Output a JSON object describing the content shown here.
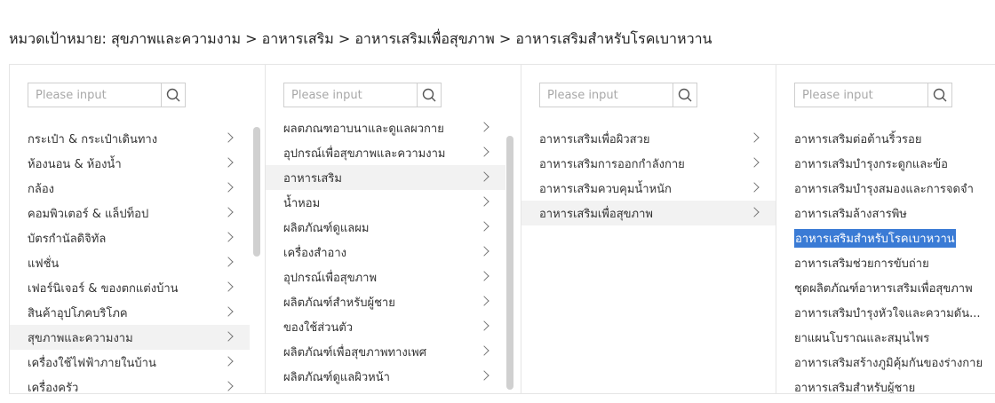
{
  "breadcrumb": {
    "text": "หมวดเป้าหมาย: สุขภาพและความงาม > อาหารเสริม > อาหารเสริมเพื่อสุขภาพ > อาหารเสริมสำหรับโรคเบาหวาน"
  },
  "search_placeholder": "Please input",
  "columns": [
    {
      "items": [
        {
          "label": "กระเป๋า & กระเป๋าเดินทาง"
        },
        {
          "label": "ห้องนอน & ห้องน้ำ"
        },
        {
          "label": "กล้อง"
        },
        {
          "label": "คอมพิวเตอร์ & แล็ปท็อป"
        },
        {
          "label": "บัตรกำนัลดิจิทัล"
        },
        {
          "label": "แฟชั่น"
        },
        {
          "label": "เฟอร์นิเจอร์ & ของตกแต่งบ้าน"
        },
        {
          "label": "สินค้าอุปโภคบริโภค"
        },
        {
          "label": "สุขภาพและความงาม"
        },
        {
          "label": "เครื่องใช้ไฟฟ้าภายในบ้าน"
        },
        {
          "label": "เครื่องครัว"
        }
      ],
      "selected": "สุขภาพและความงาม"
    },
    {
      "items": [
        {
          "label": "ผลตภณฑอาบนาและดูแลผวกาย"
        },
        {
          "label": "อุปกรณ์เพื่อสุขภาพและความงาม"
        },
        {
          "label": "อาหารเสริม"
        },
        {
          "label": "น้ำหอม"
        },
        {
          "label": "ผลิตภัณฑ์ดูแลผม"
        },
        {
          "label": "เครื่องสำอาง"
        },
        {
          "label": "อุปกรณ์เพื่อสุขภาพ"
        },
        {
          "label": "ผลิตภัณฑ์สำหรับผู้ชาย"
        },
        {
          "label": "ของใช้ส่วนตัว"
        },
        {
          "label": "ผลิตภัณฑ์เพื่อสุขภาพทางเพศ"
        },
        {
          "label": "ผลิตภัณฑ์ดูแลผิวหน้า"
        }
      ],
      "selected": "อาหารเสริม"
    },
    {
      "items": [
        {
          "label": "อาหารเสริมเพื่อผิวสวย"
        },
        {
          "label": "อาหารเสริมการออกกำลังกาย"
        },
        {
          "label": "อาหารเสริมควบคุมน้ำหนัก"
        },
        {
          "label": "อาหารเสริมเพื่อสุขภาพ"
        }
      ],
      "selected": "อาหารเสริมเพื่อสุขภาพ"
    },
    {
      "items": [
        {
          "label": "อาหารเสริมต่อต้านริ้วรอย"
        },
        {
          "label": "อาหารเสริมบำรุงกระดูกและข้อ"
        },
        {
          "label": "อาหารเสริมบำรุงสมองและการจดจำ"
        },
        {
          "label": "อาหารเสริมล้างสารพิษ"
        },
        {
          "label": "อาหารเสริมสำหรับโรคเบาหวาน"
        },
        {
          "label": "อาหารเสริมช่วยการขับถ่าย"
        },
        {
          "label": "ชุดผลิตภัณฑ์อาหารเสริมเพื่อสุขภาพ"
        },
        {
          "label": "อาหารเสริมบำรุงหัวใจและความดัน..."
        },
        {
          "label": "ยาแผนโบราณและสมุนไพร"
        },
        {
          "label": "อาหารเสริมสร้างภูมิคุ้มกันของร่างกาย"
        },
        {
          "label": "อาหารเสริมสำหรับผู้ชาย"
        }
      ],
      "selected": "อาหารเสริมสำหรับโรคเบาหวาน"
    }
  ]
}
